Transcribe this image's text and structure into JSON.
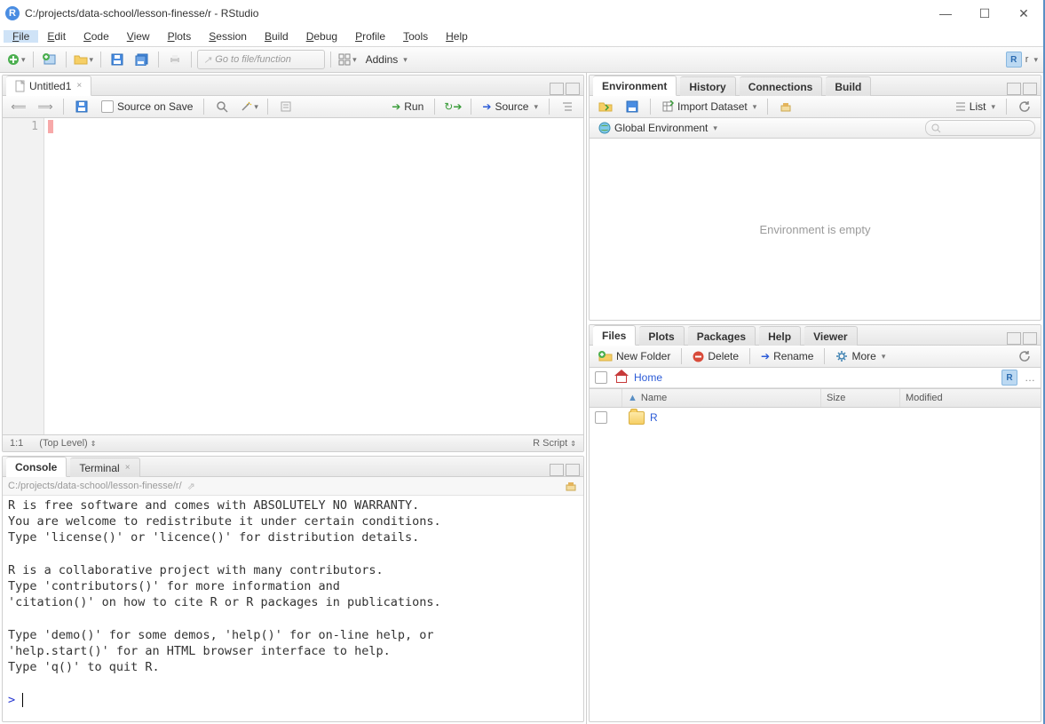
{
  "window_title": "C:/projects/data-school/lesson-finesse/r - RStudio",
  "menu": [
    "File",
    "Edit",
    "Code",
    "View",
    "Plots",
    "Session",
    "Build",
    "Debug",
    "Profile",
    "Tools",
    "Help"
  ],
  "main_toolbar": {
    "goto_placeholder": "Go to file/function",
    "addins": "Addins",
    "project": "r"
  },
  "source": {
    "tab": "Untitled1",
    "source_on_save": "Source on Save",
    "run": "Run",
    "source": "Source",
    "line": "1",
    "cursor": "1:1",
    "scope": "(Top Level)",
    "type": "R Script"
  },
  "console": {
    "tab1": "Console",
    "tab2": "Terminal",
    "path": "C:/projects/data-school/lesson-finesse/r/",
    "text": "R is free software and comes with ABSOLUTELY NO WARRANTY.\nYou are welcome to redistribute it under certain conditions.\nType 'license()' or 'licence()' for distribution details.\n\nR is a collaborative project with many contributors.\nType 'contributors()' for more information and\n'citation()' on how to cite R or R packages in publications.\n\nType 'demo()' for some demos, 'help()' for on-line help, or\n'help.start()' for an HTML browser interface to help.\nType 'q()' to quit R.\n",
    "prompt": "> "
  },
  "env": {
    "tabs": [
      "Environment",
      "History",
      "Connections",
      "Build"
    ],
    "import": "Import Dataset",
    "list": "List",
    "scope": "Global Environment",
    "empty": "Environment is empty"
  },
  "files": {
    "tabs": [
      "Files",
      "Plots",
      "Packages",
      "Help",
      "Viewer"
    ],
    "new_folder": "New Folder",
    "delete": "Delete",
    "rename": "Rename",
    "more": "More",
    "home": "Home",
    "cols": {
      "name": "Name",
      "size": "Size",
      "modified": "Modified"
    },
    "items": [
      {
        "name": "R"
      }
    ]
  }
}
